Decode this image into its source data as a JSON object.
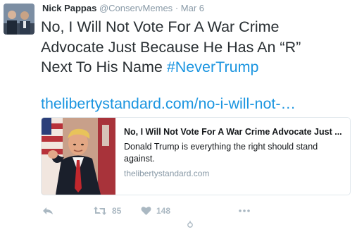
{
  "tweet": {
    "author_name": "Nick Pappas",
    "author_handle": "@ConservMemes",
    "separator": "·",
    "date": "Mar 6",
    "text_lines": [
      "No, I Will Not Vote For A War Crime",
      "Advocate Just Because He Has An “R”"
    ],
    "text_line3_plain": "Next To His Name ",
    "hashtag": "#NeverTrump",
    "link_text": "thelibertystandard.com/no-i-will-not-…"
  },
  "card": {
    "title": "No, I Will Not Vote For A War Crime Advocate Just ...",
    "description_line1": "Donald Trump is everything the right should stand",
    "description_line2": "against.",
    "domain": "thelibertystandard.com"
  },
  "actions": {
    "retweet_count": "85",
    "like_count": "148",
    "reply_icon": "reply-icon",
    "retweet_icon": "retweet-icon",
    "like_icon": "heart-icon",
    "more_icon": "more-icon"
  },
  "colors": {
    "link": "#1b95e0",
    "text": "#292f33",
    "muted": "#8899a6",
    "icon": "#aab8c2"
  }
}
